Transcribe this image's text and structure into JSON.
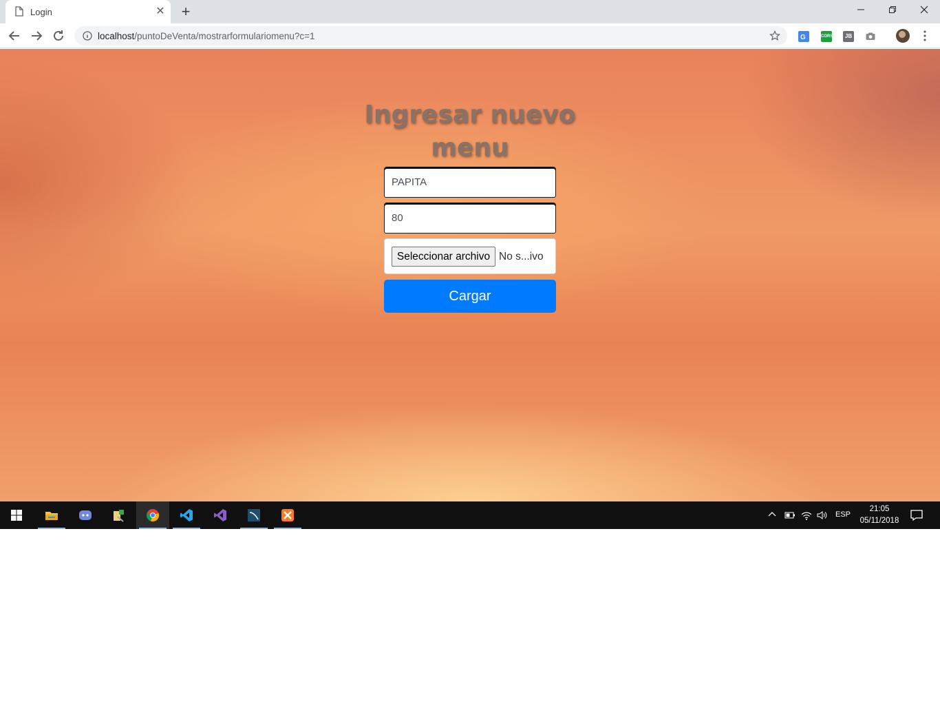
{
  "browser": {
    "tab_title": "Login",
    "url_host": "localhost",
    "url_path": "/puntoDeVenta/mostrarformulariomenu?c=1",
    "extensions": [
      "google-translate-icon",
      "cors-icon",
      "jb-icon",
      "camera-icon"
    ],
    "ext_cors_label": "CORS",
    "ext_jb_label": "JB"
  },
  "page": {
    "heading": "Ingresar nuevo menu",
    "name_value": "PAPITA",
    "price_value": "80",
    "file_button_label": "Seleccionar archivo",
    "file_status": "No s...ivo",
    "submit_label": "Cargar",
    "colors": {
      "submit": "#007bff",
      "heading": "#8a7266"
    }
  },
  "taskbar": {
    "apps": [
      "windows-start",
      "file-explorer",
      "discord",
      "app-tool",
      "chrome",
      "vscode",
      "visual-studio",
      "mysql-workbench",
      "xampp"
    ],
    "language": "ESP",
    "time": "21:05",
    "date": "05/11/2018"
  }
}
